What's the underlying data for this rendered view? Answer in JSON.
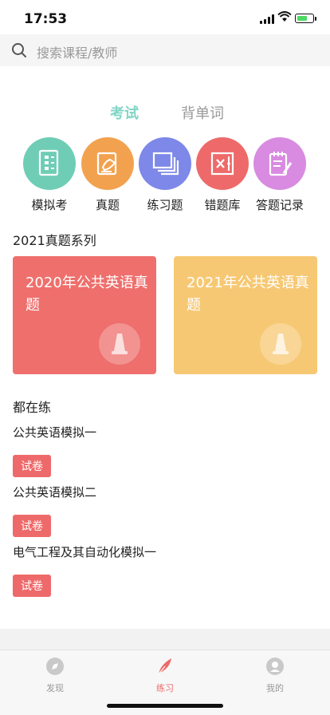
{
  "status_bar": {
    "time": "17:53"
  },
  "search": {
    "placeholder": "搜索课程/教师"
  },
  "tabs": [
    {
      "label": "考试",
      "active": true
    },
    {
      "label": "背单词",
      "active": false
    }
  ],
  "categories": [
    {
      "label": "模拟考",
      "icon": "exam-sheet-icon",
      "color": "#6fcdb6"
    },
    {
      "label": "真题",
      "icon": "writing-hand-icon",
      "color": "#f2a24f"
    },
    {
      "label": "练习题",
      "icon": "stacked-pages-icon",
      "color": "#7e88e8"
    },
    {
      "label": "错题库",
      "icon": "wrong-box-icon",
      "color": "#ee6a6a"
    },
    {
      "label": "答题记录",
      "icon": "notepad-pencil-icon",
      "color": "#d88be0"
    }
  ],
  "series": {
    "title": "2021真题系列",
    "cards": [
      {
        "title": "2020年公共英语真题",
        "color": "#ee6f6c"
      },
      {
        "title": "2021年公共英语真题",
        "color": "#f7c873"
      }
    ]
  },
  "practicing": {
    "title": "都在练",
    "items": [
      {
        "name": "公共英语模拟一",
        "tag": "试卷"
      },
      {
        "name": "公共英语模拟二",
        "tag": "试卷"
      },
      {
        "name": "电气工程及其自动化模拟一",
        "tag": "试卷"
      }
    ]
  },
  "tabbar": {
    "items": [
      {
        "label": "发现",
        "icon": "compass-icon",
        "active": false
      },
      {
        "label": "练习",
        "icon": "feather-icon",
        "active": true
      },
      {
        "label": "我的",
        "icon": "user-icon",
        "active": false
      }
    ],
    "active_color": "#ee6a6a",
    "inactive_color": "#999999"
  }
}
